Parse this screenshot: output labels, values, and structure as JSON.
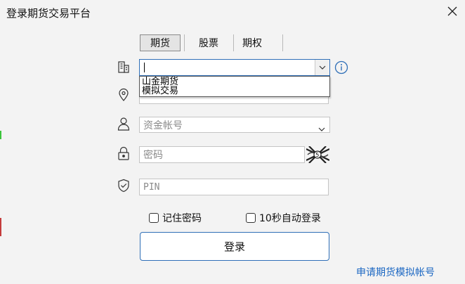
{
  "window": {
    "title": "登录期货交易平台"
  },
  "tabs": [
    {
      "label": "期货",
      "active": true
    },
    {
      "label": "股票",
      "active": false
    },
    {
      "label": "期权",
      "active": false
    }
  ],
  "broker": {
    "value": "",
    "options": [
      "山金期货",
      "模拟交易"
    ]
  },
  "account": {
    "placeholder": "资金帐号"
  },
  "password": {
    "placeholder": "密码"
  },
  "pin": {
    "placeholder": "PIN"
  },
  "remember": {
    "label": "记住密码",
    "checked": false
  },
  "auto_login": {
    "label": "10秒自动登录",
    "checked": false
  },
  "login_button": {
    "label": "登录"
  },
  "apply_link": {
    "label": "申请期货模拟帐号"
  },
  "colors": {
    "accent": "#2f6fb7",
    "link": "#1a66c2",
    "background": "#f3f3f3"
  },
  "icons": [
    "building-icon",
    "location-pin-icon",
    "user-icon",
    "lock-icon",
    "shield-check-icon",
    "info-icon",
    "close-icon",
    "chevron-down-icon"
  ]
}
